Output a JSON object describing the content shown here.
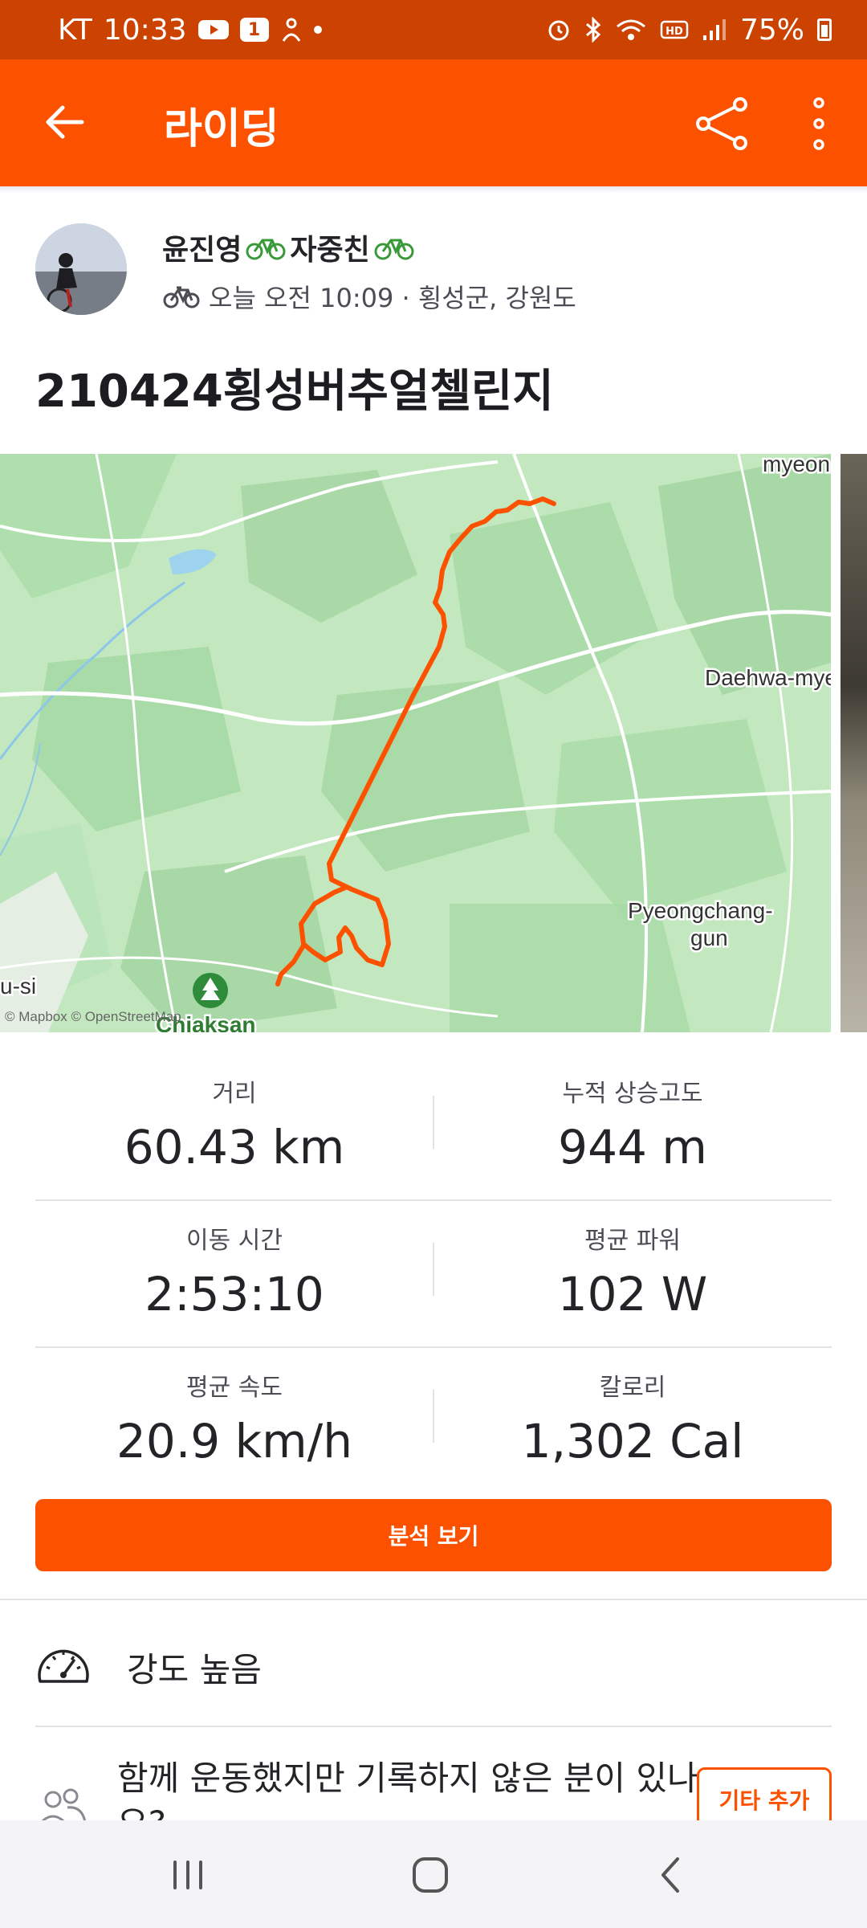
{
  "status_bar": {
    "carrier": "KT",
    "time": "10:33",
    "notification_badge": "1",
    "battery_percent": "75%",
    "icons": [
      "youtube-icon",
      "notification-badge-icon",
      "app-icon",
      "dot-icon",
      "alarm-icon",
      "bluetooth-icon",
      "wifi-icon",
      "hd-icon",
      "signal-icon",
      "battery-icon"
    ]
  },
  "app_bar": {
    "title": "라이딩",
    "icons": [
      "back-arrow-icon",
      "share-icon",
      "more-vertical-icon"
    ]
  },
  "athlete": {
    "name": "윤진영",
    "badge_text": "자중친",
    "activity_icon": "bicycle-icon",
    "meta": "오늘 오전 10:09 · 횡성군, 강원도"
  },
  "activity": {
    "title": "210424횡성버추얼첼린지"
  },
  "map": {
    "labels": {
      "top_right": "myeon",
      "right": "Daehwa-myeo",
      "pyeongchang_line1": "Pyeongchang-",
      "pyeongchang_line2": "gun",
      "left": "u-si",
      "bottom": "Chiaksan",
      "attribution": "© Mapbox © OpenStreetMap"
    },
    "route_color": "#fc5200"
  },
  "stats": [
    {
      "label": "거리",
      "value": "60.43 km"
    },
    {
      "label": "누적 상승고도",
      "value": "944 m"
    },
    {
      "label": "이동 시간",
      "value": "2:53:10"
    },
    {
      "label": "평균 파워",
      "value": "102 W"
    },
    {
      "label": "평균 속도",
      "value": "20.9 km/h"
    },
    {
      "label": "칼로리",
      "value": "1,302 Cal"
    }
  ],
  "analysis_button": "분석 보기",
  "intensity": {
    "icon": "gauge-icon",
    "text": "강도 높음"
  },
  "group": {
    "icon": "group-icon",
    "text": "함께 운동했지만 기록하지 않은 분이 있나요?",
    "button": "기타 추가"
  },
  "nav_bar": {
    "icons": [
      "recent-apps-icon",
      "home-icon",
      "back-icon"
    ]
  },
  "colors": {
    "brand": "#fc5200",
    "status_bar": "#cc4200",
    "map_green": "#c7ebc4"
  }
}
